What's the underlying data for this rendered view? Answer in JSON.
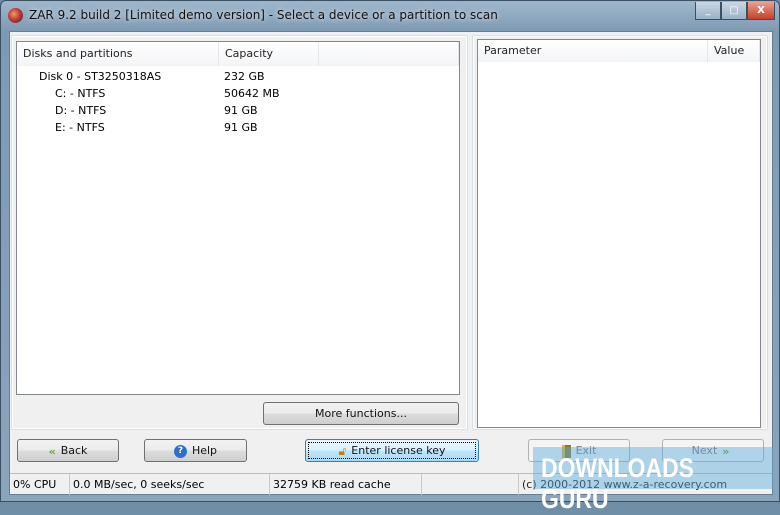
{
  "window": {
    "title": "ZAR 9.2 build 2 [Limited demo version] - Select a device or a partition to scan",
    "minimize": "_",
    "maximize": "□",
    "close": "X"
  },
  "disks": {
    "columns": [
      "Disks and partitions",
      "Capacity"
    ],
    "rows": [
      {
        "name": "Disk 0 - ST3250318AS",
        "capacity": "232 GB"
      },
      {
        "name": "C: - NTFS",
        "capacity": "50642 MB"
      },
      {
        "name": "D: - NTFS",
        "capacity": "91 GB"
      },
      {
        "name": "E: - NTFS",
        "capacity": "91 GB"
      }
    ]
  },
  "params": {
    "columns": [
      "Parameter",
      "Value"
    ]
  },
  "buttons": {
    "more": "More functions...",
    "back": "Back",
    "help": "Help",
    "license": "Enter license key",
    "exit": "Exit",
    "next": "Next"
  },
  "status": {
    "cpu": "0% CPU",
    "io": "0.0 MB/sec, 0 seeks/sec",
    "cache": "32759 KB read cache",
    "blank": "",
    "copyright": "(c) 2000-2012 www.z-a-recovery.com"
  },
  "watermark": "DOWNLOADS GURU"
}
